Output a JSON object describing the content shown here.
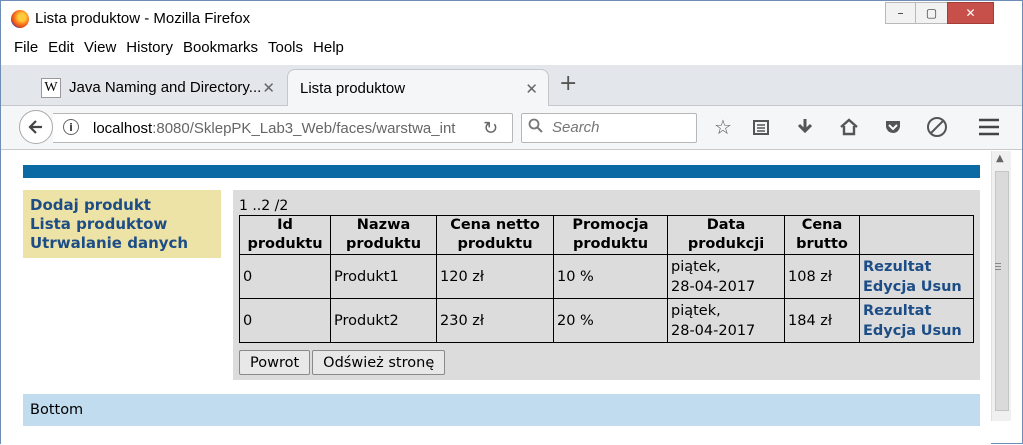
{
  "window": {
    "title": "Lista produktow - Mozilla Firefox",
    "controls": {
      "minimize": "–",
      "maximize": "▢",
      "close": "✕"
    }
  },
  "menu": [
    "File",
    "Edit",
    "View",
    "History",
    "Bookmarks",
    "Tools",
    "Help"
  ],
  "tabs": [
    {
      "label": "Java Naming and Directory...",
      "icon": "wikipedia-icon",
      "close": "✕"
    },
    {
      "label": "Lista produktow",
      "close": "✕",
      "active": true
    }
  ],
  "newtab": "+",
  "nav": {
    "url_host": "localhost",
    "url_rest": ":8080/SklepPK_Lab3_Web/faces/warstwa_int",
    "search_placeholder": "Search"
  },
  "page": {
    "sidebar": [
      "Dodaj produkt",
      "Lista produktow",
      "Utrwalanie danych"
    ],
    "pager": "1 ..2 /2",
    "table": {
      "headers": [
        [
          "Id",
          "produktu"
        ],
        [
          "Nazwa",
          "produktu"
        ],
        [
          "Cena netto",
          "produktu"
        ],
        [
          "Promocja",
          "produktu"
        ],
        [
          "Data",
          "produkcji"
        ],
        [
          "Cena",
          "brutto"
        ],
        [
          "",
          ""
        ]
      ],
      "rows": [
        {
          "id": "0",
          "name": "Produkt1",
          "netto": "120 zł",
          "promo": "10 %",
          "date1": "piątek,",
          "date2": "28-04-2017",
          "brutto": "108 zł",
          "link1": "Rezultat",
          "link2": "Edycja",
          "link3": "Usun"
        },
        {
          "id": "0",
          "name": "Produkt2",
          "netto": "230 zł",
          "promo": "20 %",
          "date1": "piątek,",
          "date2": "28-04-2017",
          "brutto": "184 zł",
          "link1": "Rezultat",
          "link2": "Edycja",
          "link3": "Usun"
        }
      ]
    },
    "buttons": {
      "back": "Powrot",
      "refresh": "Odśwież stronę"
    },
    "bottom": "Bottom"
  },
  "colors": {
    "bluebar": "#0b6aa4",
    "sidebar": "#ede3a6",
    "panel": "#dcdcdc",
    "bottom": "#c2dcef",
    "link": "#1d4d86"
  }
}
